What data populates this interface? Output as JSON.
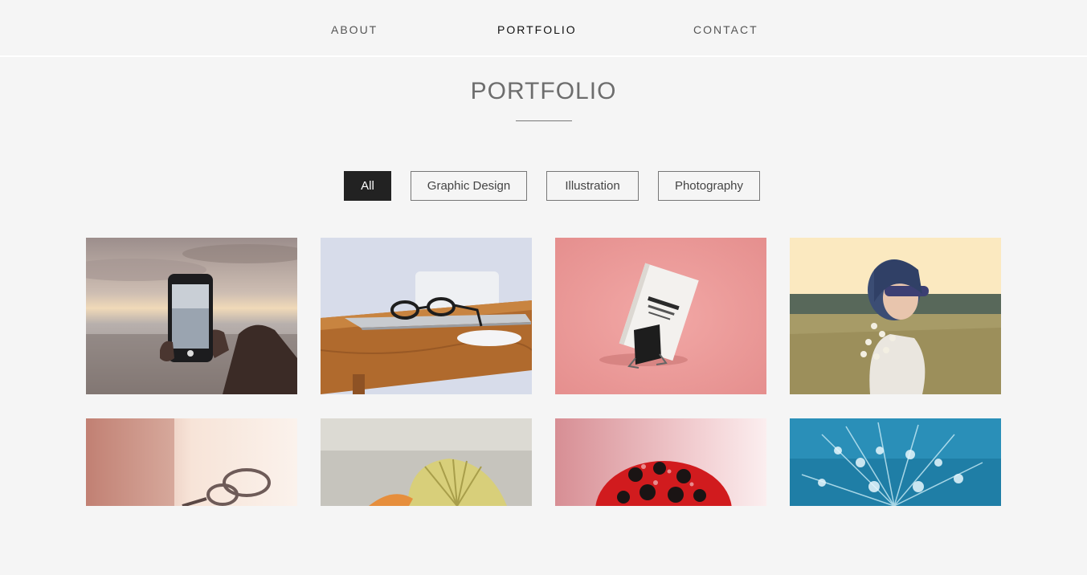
{
  "nav": {
    "items": [
      {
        "label": "ABOUT",
        "active": false
      },
      {
        "label": "PORTFOLIO",
        "active": true
      },
      {
        "label": "CONTACT",
        "active": false
      }
    ]
  },
  "header": {
    "title": "PORTFOLIO"
  },
  "filters": {
    "items": [
      {
        "label": "All",
        "active": true
      },
      {
        "label": "Graphic Design",
        "active": false
      },
      {
        "label": "Illustration",
        "active": false
      },
      {
        "label": "Photography",
        "active": false
      }
    ]
  },
  "portfolio": {
    "items": [
      {
        "subject": "hand holding smartphone at seaside"
      },
      {
        "subject": "glasses on laptop on wooden desk"
      },
      {
        "subject": "business card mockup on binder clip"
      },
      {
        "subject": "woman in sunglasses with flowers"
      },
      {
        "subject": "glasses in soft pink light"
      },
      {
        "subject": "yellow seashell"
      },
      {
        "subject": "ladybug with water drops"
      },
      {
        "subject": "blue dandelion with water drops"
      }
    ]
  },
  "colors": {
    "background": "#f5f5f5",
    "active_filter": "#222222",
    "nav_text": "#555555",
    "title_text": "#6d6d6d"
  }
}
